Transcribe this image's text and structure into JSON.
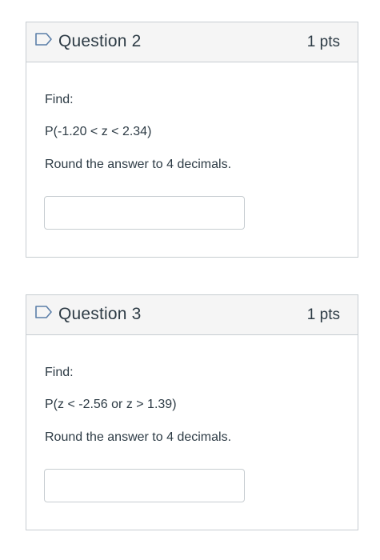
{
  "questions": [
    {
      "title": "Question 2",
      "points": "1 pts",
      "prompt": "Find:",
      "expression": "P(-1.20 < z < 2.34)",
      "instruction": "Round the answer to 4 decimals.",
      "answer_value": ""
    },
    {
      "title": "Question 3",
      "points": "1 pts",
      "prompt": "Find:",
      "expression": "P(z < -2.56 or z > 1.39)",
      "instruction": "Round the answer to 4 decimals.",
      "answer_value": ""
    }
  ],
  "icons": {
    "flag": "flag-icon"
  },
  "colors": {
    "header_bg": "#f5f5f5",
    "border": "#c7cdd1",
    "text": "#2d3b45",
    "flag_stroke": "#5b7ea8"
  }
}
